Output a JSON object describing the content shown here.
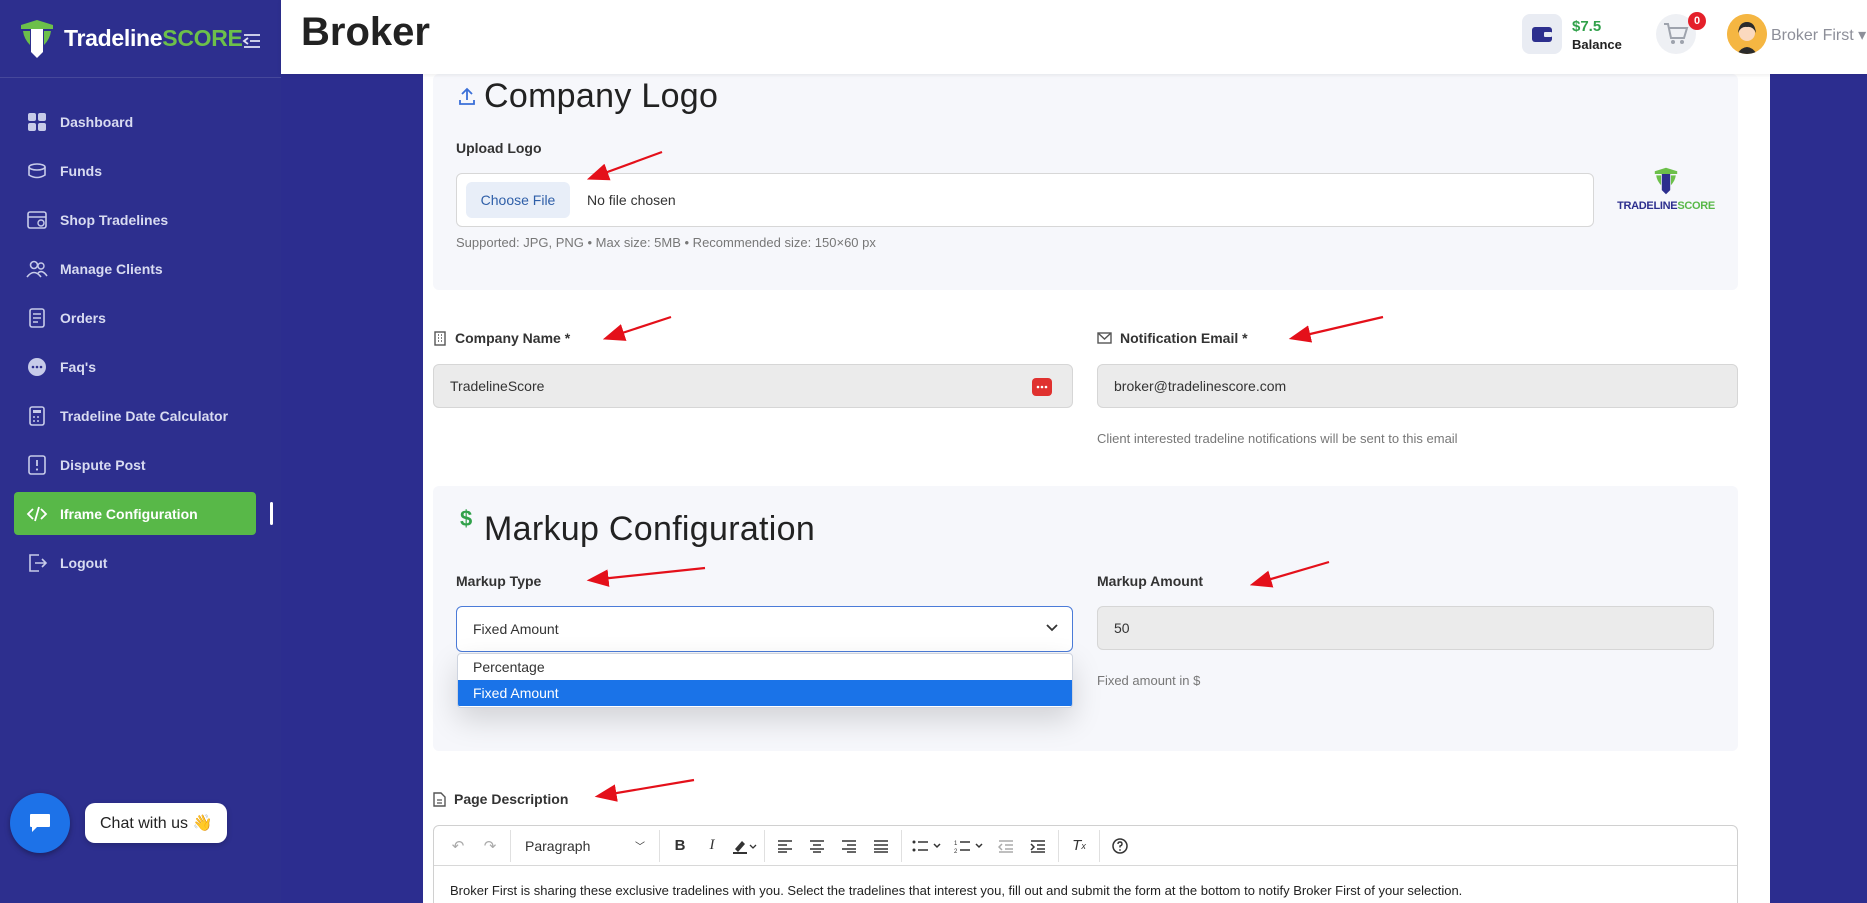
{
  "brand": {
    "name_main": "Tradeline",
    "name_accent": "SCORE"
  },
  "sidebar": {
    "items": [
      {
        "label": "Dashboard",
        "icon": "dashboard-icon"
      },
      {
        "label": "Funds",
        "icon": "funds-icon"
      },
      {
        "label": "Shop Tradelines",
        "icon": "shop-icon"
      },
      {
        "label": "Manage Clients",
        "icon": "clients-icon"
      },
      {
        "label": "Orders",
        "icon": "orders-icon"
      },
      {
        "label": "Faq's",
        "icon": "faq-icon"
      },
      {
        "label": "Tradeline Date Calculator",
        "icon": "calculator-icon"
      },
      {
        "label": "Dispute Post",
        "icon": "dispute-icon"
      },
      {
        "label": "Iframe Configuration",
        "icon": "code-icon",
        "active": true
      },
      {
        "label": "Logout",
        "icon": "logout-icon"
      }
    ]
  },
  "chat": {
    "label": "Chat with us 👋"
  },
  "header": {
    "title": "Broker",
    "balance_amount": "$7.5",
    "balance_label": "Balance",
    "cart_count": "0",
    "user_name": "Broker First"
  },
  "logo_section": {
    "title": "Company Logo",
    "upload_label": "Upload Logo",
    "choose_button": "Choose File",
    "no_file_text": "No file chosen",
    "hint": "Supported: JPG, PNG • Max size: 5MB • Recommended size: 150×60 px",
    "preview_main": "TRADELINE",
    "preview_accent": "SCORE"
  },
  "company": {
    "name_label": "Company Name *",
    "name_value": "TradelineScore",
    "email_label": "Notification Email *",
    "email_value": "broker@tradelinescore.com",
    "email_hint": "Client interested tradeline notifications will be sent to this email"
  },
  "markup": {
    "title": "Markup Configuration",
    "type_label": "Markup Type",
    "type_value": "Fixed Amount",
    "options": [
      "Percentage",
      "Fixed Amount"
    ],
    "amount_label": "Markup Amount",
    "amount_value": "50",
    "amount_hint": "Fixed amount in $"
  },
  "description": {
    "label": "Page Description",
    "block_format": "Paragraph",
    "text": "Broker First is sharing these exclusive tradelines with you. Select the tradelines that interest you, fill out and submit the form at the bottom to notify Broker First of your selection."
  },
  "colors": {
    "sidebar": "#2d2f8e",
    "accent_green": "#58b848",
    "primary_blue": "#1a73e8",
    "annotation_red": "#e4101a"
  }
}
